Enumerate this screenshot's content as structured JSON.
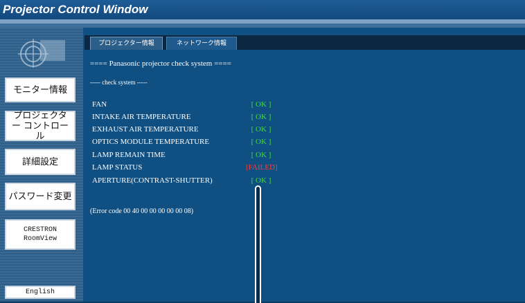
{
  "window": {
    "title": "Projector Control Window"
  },
  "sidebar": {
    "buttons": [
      {
        "label": "モニター情報"
      },
      {
        "label": "プロジェクター コントロール"
      },
      {
        "label": "詳細設定"
      },
      {
        "label": "パスワード変更"
      },
      {
        "label": "CRESTRON RoomView"
      },
      {
        "label": "English"
      }
    ]
  },
  "tabs": [
    {
      "label": "プロジェクター情報",
      "active": true
    },
    {
      "label": "ネットワーク情報",
      "active": false
    }
  ],
  "main": {
    "header": "==== Panasonic projector check system ====",
    "subheader": "----- check system -----",
    "rows": [
      {
        "label": "FAN",
        "status": "[ OK ]",
        "state": "ok"
      },
      {
        "label": "INTAKE AIR TEMPERATURE",
        "status": "[ OK ]",
        "state": "ok"
      },
      {
        "label": "EXHAUST AIR TEMPERATURE",
        "status": "[ OK ]",
        "state": "ok"
      },
      {
        "label": "OPTICS MODULE TEMPERATURE",
        "status": "[ OK ]",
        "state": "ok"
      },
      {
        "label": "LAMP REMAIN TIME",
        "status": "[ OK ]",
        "state": "ok"
      },
      {
        "label": "LAMP STATUS",
        "status": "[FAILED]",
        "state": "failed"
      },
      {
        "label": "APERTURE(CONTRAST-SHUTTER)",
        "status": "[ OK ]",
        "state": "ok"
      }
    ],
    "error_code": "(Error code 00 40 00 00 00 00 00 08)"
  },
  "colors": {
    "ok": "#3fdc3f",
    "failed": "#ff3b2f",
    "background": "#104f82",
    "title_bar": "#12497d"
  }
}
